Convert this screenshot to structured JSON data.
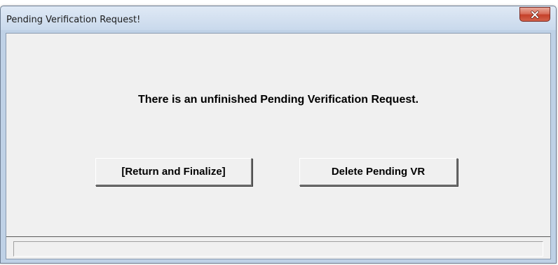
{
  "window": {
    "title": "Pending Verification Request!",
    "close_icon": "close-icon"
  },
  "dialog": {
    "message": "There is an unfinished Pending Verification Request.",
    "buttons": {
      "return_label": "[Return and Finalize]",
      "delete_label": "Delete Pending VR"
    },
    "status_text": ""
  },
  "colors": {
    "client_background": "#f0f0f0",
    "close_button": "#c4412a",
    "title_bar": "#c9d9ec"
  }
}
